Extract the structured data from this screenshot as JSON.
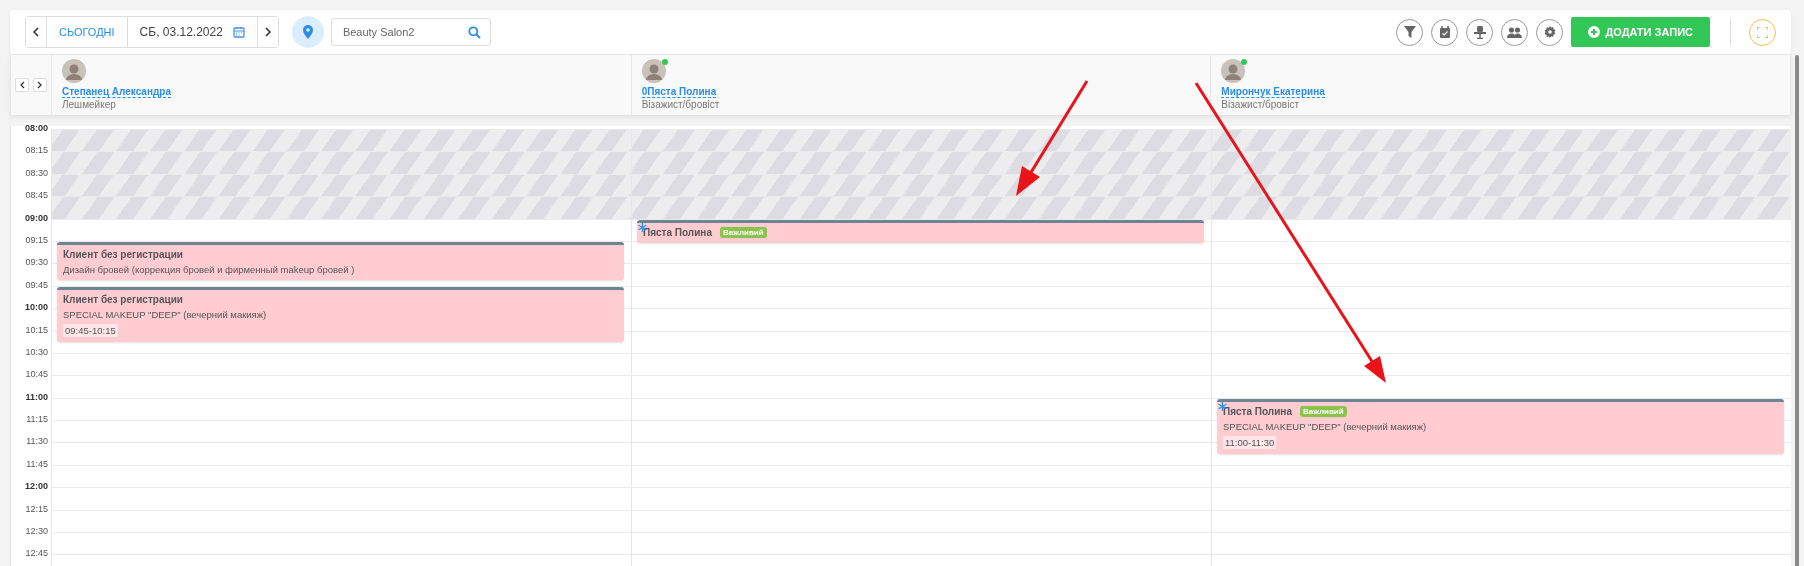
{
  "toolbar": {
    "today": "СЬОГОДНІ",
    "date": "СБ, 03.12.2022",
    "search": {
      "value": "Beauty Salon2"
    },
    "add_button": "ДОДАТИ ЗАПИС"
  },
  "staff": [
    {
      "name": "Степанец Александра",
      "role": "Лешмейкер",
      "online": false
    },
    {
      "name": "0Пяста Полина",
      "role": "Візажист/бровіст",
      "online": true
    },
    {
      "name": "Мирончук Екатерина",
      "role": "Візажист/бровіст",
      "online": true
    }
  ],
  "slots": [
    {
      "time": "08:00",
      "blocked": true,
      "cells": [
        {},
        {},
        {}
      ]
    },
    {
      "time": "08:15",
      "blocked": true,
      "cells": [
        {},
        {},
        {}
      ]
    },
    {
      "time": "08:30",
      "blocked": true,
      "cells": [
        {},
        {},
        {}
      ]
    },
    {
      "time": "08:45",
      "blocked": true,
      "cells": [
        {},
        {},
        {}
      ]
    },
    {
      "time": "09:00",
      "blocked": false,
      "cells": [
        {},
        {
          "appointment": {
            "client": "Пяста Полина",
            "flagged": true,
            "tag": "Важливий"
          }
        },
        {}
      ]
    },
    {
      "time": "09:15",
      "blocked": false,
      "cells": [
        {
          "appointment": {
            "client": "Клиент без регистрации",
            "flagged": false,
            "service": "Дизайн бровей (коррекция бровей и фирменный makeup бровей )"
          }
        },
        {},
        {}
      ]
    },
    {
      "time": "09:30",
      "blocked": false,
      "cells": [
        {},
        {},
        {}
      ]
    },
    {
      "time": "09:45",
      "blocked": false,
      "cells": [
        {
          "appointment": {
            "client": "Клиент без регистрации",
            "flagged": false,
            "service": "SPECIAL MAKEUP \"DEEP\" (вечерний макияж)",
            "time": "09:45-10:15"
          }
        },
        {},
        {}
      ]
    },
    {
      "time": "10:00",
      "blocked": false,
      "cells": [
        {},
        {},
        {}
      ]
    },
    {
      "time": "10:15",
      "blocked": false,
      "cells": [
        {},
        {},
        {}
      ]
    },
    {
      "time": "10:30",
      "blocked": false,
      "cells": [
        {},
        {},
        {}
      ]
    },
    {
      "time": "10:45",
      "blocked": false,
      "cells": [
        {},
        {},
        {}
      ]
    },
    {
      "time": "11:00",
      "blocked": false,
      "cells": [
        {},
        {},
        {
          "appointment": {
            "client": "Пяста Полина",
            "flagged": true,
            "tag": "Важливий",
            "service": "SPECIAL MAKEUP \"DEEP\" (вечерний макияж)",
            "time": "11:00-11:30"
          }
        }
      ]
    },
    {
      "time": "11:15",
      "blocked": false,
      "cells": [
        {},
        {},
        {}
      ]
    },
    {
      "time": "11:30",
      "blocked": false,
      "cells": [
        {},
        {},
        {}
      ]
    },
    {
      "time": "11:45",
      "blocked": false,
      "cells": [
        {},
        {},
        {}
      ]
    },
    {
      "time": "12:00",
      "blocked": false,
      "cells": [
        {},
        {},
        {}
      ]
    },
    {
      "time": "12:15",
      "blocked": false,
      "cells": [
        {},
        {},
        {}
      ]
    },
    {
      "time": "12:30",
      "blocked": false,
      "cells": [
        {},
        {},
        {}
      ]
    },
    {
      "time": "12:45",
      "blocked": false,
      "cells": [
        {},
        {},
        {}
      ]
    }
  ]
}
